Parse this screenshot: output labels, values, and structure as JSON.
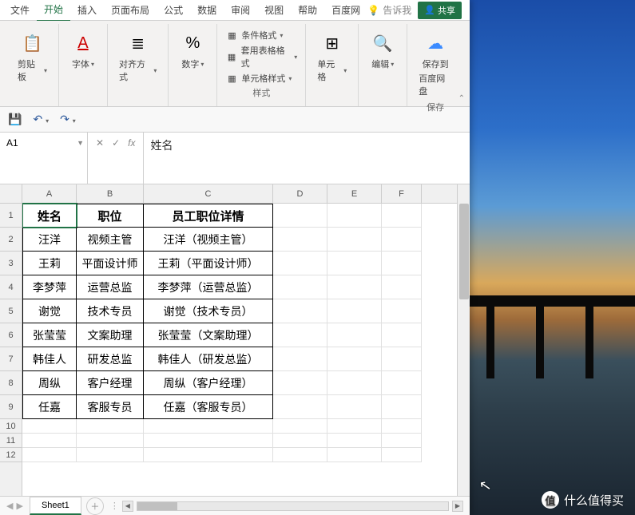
{
  "tabs": {
    "file": "文件",
    "home": "开始",
    "insert": "插入",
    "layout": "页面布局",
    "formula": "公式",
    "data": "数据",
    "review": "审阅",
    "view": "视图",
    "help": "帮助",
    "baidu": "百度网"
  },
  "tell": "告诉我",
  "share": "共享",
  "ribbon": {
    "clipboard": "剪贴板",
    "font": "字体",
    "align": "对齐方式",
    "number": "数字",
    "styles": "样式",
    "cells": "单元格",
    "editing": "编辑",
    "save_group": "保存",
    "cond_fmt": "条件格式",
    "tbl_fmt": "套用表格格式",
    "cell_style": "单元格样式",
    "save_to": "保存到",
    "save_to2": "百度网盘"
  },
  "namebox": "A1",
  "formula_value": "姓名",
  "columns": [
    "A",
    "B",
    "C",
    "D",
    "E",
    "F"
  ],
  "headers": {
    "c0": "姓名",
    "c1": "职位",
    "c2": "员工职位详情"
  },
  "rows": [
    {
      "c0": "汪洋",
      "c1": "视频主管",
      "c2": "汪洋（视频主管）"
    },
    {
      "c0": "王莉",
      "c1": "平面设计师",
      "c2": "王莉（平面设计师）"
    },
    {
      "c0": "李梦萍",
      "c1": "运营总监",
      "c2": "李梦萍（运营总监）"
    },
    {
      "c0": "谢觉",
      "c1": "技术专员",
      "c2": "谢觉（技术专员）"
    },
    {
      "c0": "张莹莹",
      "c1": "文案助理",
      "c2": "张莹莹（文案助理）"
    },
    {
      "c0": "韩佳人",
      "c1": "研发总监",
      "c2": "韩佳人（研发总监）"
    },
    {
      "c0": "周纵",
      "c1": "客户经理",
      "c2": "周纵（客户经理）"
    },
    {
      "c0": "任嘉",
      "c1": "客服专员",
      "c2": "任嘉（客服专员）"
    }
  ],
  "sheet": "Sheet1",
  "watermark": {
    "badge": "值",
    "text": "什么值得买"
  },
  "glyph": {
    "font": "A",
    "percent": "%",
    "bulb": "💡",
    "people": "👤",
    "save": "🖫",
    "undo": "↩",
    "redo": "↪",
    "times": "✕",
    "check": "✓",
    "fx": "fx",
    "plus": "＋",
    "left": "◀",
    "right": "▶",
    "up": "▲",
    "down": "▼",
    "cloud": "☁"
  }
}
